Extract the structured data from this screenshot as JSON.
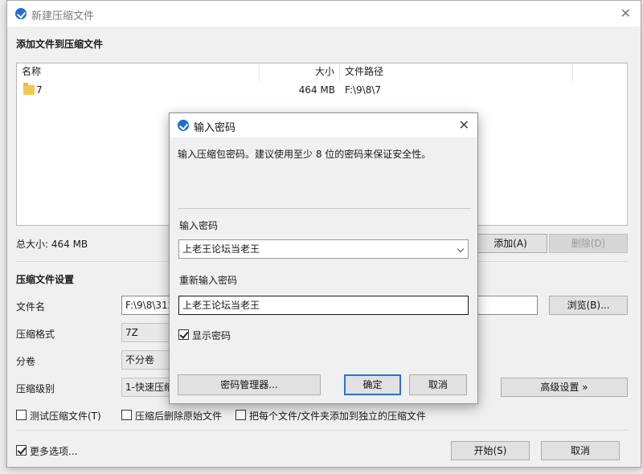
{
  "window": {
    "title": "新建压缩文件",
    "close": "✕"
  },
  "files": {
    "section_title": "添加文件到压缩文件",
    "columns": {
      "name": "名称",
      "size": "大小",
      "path": "文件路径"
    },
    "rows": [
      {
        "name": "7",
        "size": "464 MB",
        "path": "F:\\9\\8\\7"
      }
    ],
    "total": "总大小: 464 MB",
    "add_button": "添加(A)",
    "delete_button": "删除(D)"
  },
  "settings": {
    "section_title": "压缩文件设置",
    "filename_label": "文件名",
    "filename_value": "F:\\9\\8\\312",
    "browse_button": "浏览(B)...",
    "format_label": "压缩格式",
    "format_value": "7Z",
    "split_label": "分卷",
    "split_value": "不分卷",
    "level_label": "压缩级别",
    "level_value": "1-快速压缩",
    "advanced_button": "高级设置 »",
    "test_checkbox": "测试压缩文件(T)",
    "delete_after_checkbox": "压缩后删除原始文件",
    "separate_checkbox": "把每个文件/文件夹添加到独立的压缩文件"
  },
  "footer": {
    "more_options": "更多选项...",
    "start_button": "开始(S)",
    "cancel_button": "取消"
  },
  "password_dialog": {
    "title": "输入密码",
    "close": "✕",
    "hint": "输入压缩包密码。建议使用至少 8 位的密码来保证安全性。",
    "password_label": "输入密码",
    "password_value": "上老王论坛当老王",
    "confirm_label": "重新输入密码",
    "confirm_value": "上老王论坛当老王",
    "show_password": "显示密码",
    "manager_button": "密码管理器...",
    "ok_button": "确定",
    "cancel_button": "取消"
  }
}
